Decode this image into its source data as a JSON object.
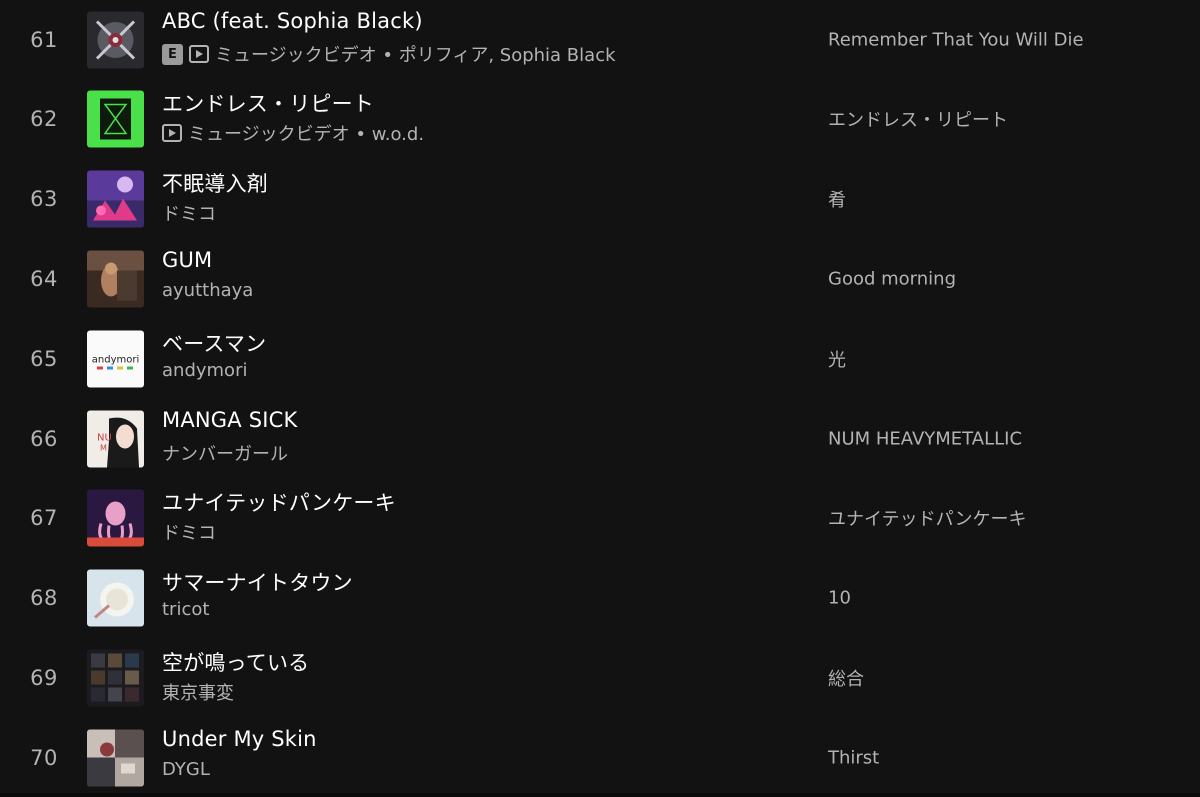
{
  "tracks": [
    {
      "num": "61",
      "title": "ABC (feat. Sophia Black)",
      "explicit": true,
      "explicit_label": "E",
      "video": true,
      "subtitle": "ミュージックビデオ • ポリフィア, Sophia Black",
      "album": "Remember That You Will Die",
      "cover_icon": "album-art-abc"
    },
    {
      "num": "62",
      "title": "エンドレス・リピート",
      "explicit": false,
      "video": true,
      "subtitle": "ミュージックビデオ • w.o.d.",
      "album": "エンドレス・リピート",
      "cover_icon": "album-art-endless-repeat"
    },
    {
      "num": "63",
      "title": "不眠導入剤",
      "explicit": false,
      "video": false,
      "subtitle": "ドミコ",
      "album": "肴",
      "cover_icon": "album-art-fumin"
    },
    {
      "num": "64",
      "title": "GUM",
      "explicit": false,
      "video": false,
      "subtitle": "ayutthaya",
      "album": "Good morning",
      "cover_icon": "album-art-gum"
    },
    {
      "num": "65",
      "title": "ベースマン",
      "explicit": false,
      "video": false,
      "subtitle": "andymori",
      "album": "光",
      "cover_icon": "album-art-hikari"
    },
    {
      "num": "66",
      "title": "MANGA SICK",
      "explicit": false,
      "video": false,
      "subtitle": "ナンバーガール",
      "album": "NUM HEAVYMETALLIC",
      "cover_icon": "album-art-num"
    },
    {
      "num": "67",
      "title": "ユナイテッドパンケーキ",
      "explicit": false,
      "video": false,
      "subtitle": "ドミコ",
      "album": "ユナイテッドパンケーキ",
      "cover_icon": "album-art-pancake"
    },
    {
      "num": "68",
      "title": "サマーナイトタウン",
      "explicit": false,
      "video": false,
      "subtitle": "tricot",
      "album": "10",
      "cover_icon": "album-art-10"
    },
    {
      "num": "69",
      "title": "空が鳴っている",
      "explicit": false,
      "video": false,
      "subtitle": "東京事変",
      "album": "総合",
      "cover_icon": "album-art-sougou"
    },
    {
      "num": "70",
      "title": "Under My Skin",
      "explicit": false,
      "video": false,
      "subtitle": "DYGL",
      "album": "Thirst",
      "cover_icon": "album-art-thirst"
    }
  ]
}
